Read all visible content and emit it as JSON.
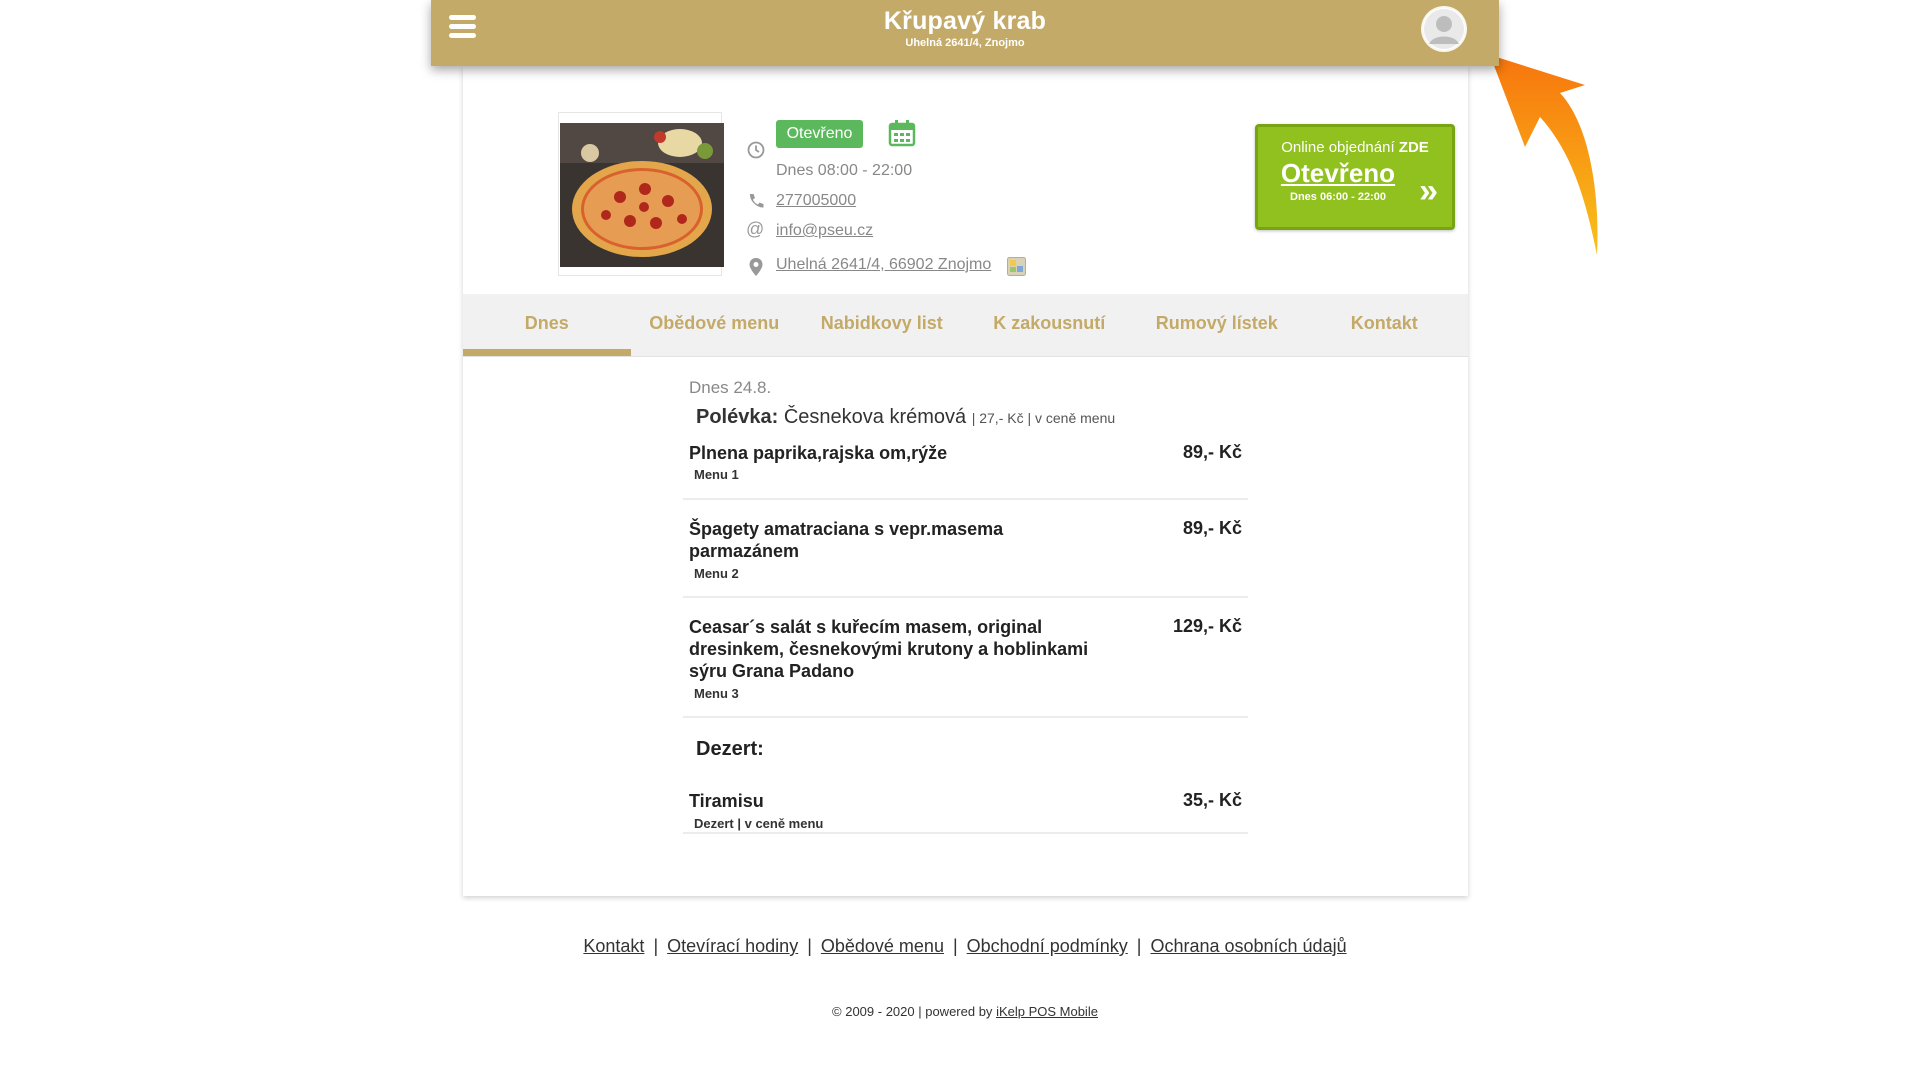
{
  "header": {
    "title": "Křupavý krab",
    "subtitle": "Uhelná 2641/4, Znojmo",
    "menu_icon": "hamburger-menu-icon",
    "account_icon": "user-avatar-icon"
  },
  "info": {
    "status": "Otevřeno",
    "hours": "Dnes 08:00 - 22:00",
    "phone": "277005000",
    "email": "info@pseu.cz",
    "address": "Uhelná 2641/4, 66902 Znojmo"
  },
  "order": {
    "lead": "Online objednání",
    "lead_strong": "ZDE",
    "status": "Otevřeno",
    "hours": "Dnes 06:00 - 22:00",
    "chevron": "»"
  },
  "tabs": [
    {
      "label": "Dnes",
      "active": true
    },
    {
      "label": "Obědové menu"
    },
    {
      "label": "Nabidkovy list"
    },
    {
      "label": "K zakousnutí"
    },
    {
      "label": "Rumový lístek"
    },
    {
      "label": "Kontakt"
    }
  ],
  "menu": {
    "date": "Dnes 24.8.",
    "soup": {
      "title": "Polévka:",
      "name": "Česnekova krémová",
      "meta": "| 27,- Kč | v ceně menu"
    },
    "items": [
      {
        "name": "Plnena paprika,rajska om,rýže",
        "price": "89,- Kč",
        "tag": "Menu 1"
      },
      {
        "name": "Špagety amatraciana s vepr.masema parmazánem",
        "price": "89,- Kč",
        "tag": "Menu 2"
      },
      {
        "name": "Ceasar´s salát s kuřecím masem, original dresinkem, česnekovými krutony a hoblinkami sýru Grana Padano",
        "price": "129,- Kč",
        "tag": "Menu 3"
      }
    ],
    "dezert_title": "Dezert:",
    "dezert": {
      "name": "Tiramisu",
      "price": "35,- Kč",
      "tag": "Dezert | v ceně menu"
    }
  },
  "footer": {
    "links": [
      "Kontakt",
      "Otevírací hodiny",
      "Obědové menu",
      "Obchodní podmínky",
      "Ochrana osobních údajů"
    ],
    "separator": "|",
    "copyright": "© 2009 - 2020 | powered by",
    "powered_link": "iKelp POS Mobile"
  },
  "colors": {
    "brand": "#c4aa68",
    "open_green": "#5cb85c",
    "order_green": "#91c11e",
    "annotation_arrow": "#f7941d"
  }
}
